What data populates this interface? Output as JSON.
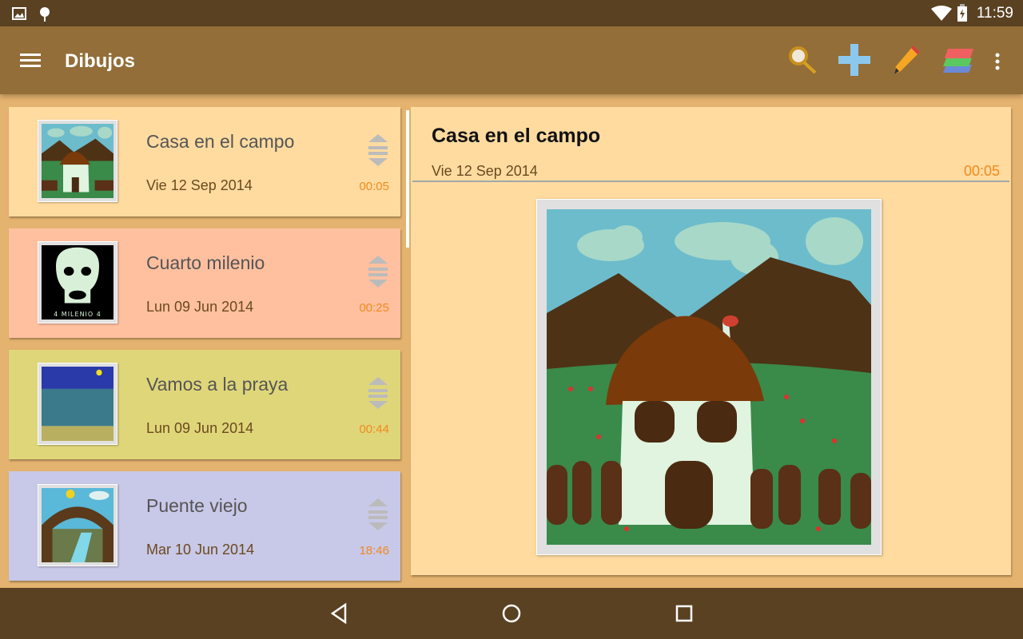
{
  "status": {
    "time": "11:59",
    "icons": [
      "image-icon",
      "android-icon",
      "wifi-icon",
      "battery-charging-icon"
    ]
  },
  "toolbar": {
    "title": "Dibujos",
    "actions": [
      "search-icon",
      "add-icon",
      "edit-pencil-icon",
      "layers-icon",
      "overflow-menu-icon"
    ]
  },
  "list": [
    {
      "title": "Casa en el campo",
      "date": "Vie 12 Sep 2014",
      "time": "00:05",
      "color": "#ffdba0"
    },
    {
      "title": "Cuarto milenio",
      "date": "Lun 09 Jun 2014",
      "time": "00:25",
      "color": "#ffc0a0",
      "thumb_caption": "4 MILENIO 4"
    },
    {
      "title": "Vamos a la praya",
      "date": "Lun 09 Jun 2014",
      "time": "00:44",
      "color": "#dfd67a"
    },
    {
      "title": "Puente viejo",
      "date": "Mar 10 Jun 2014",
      "time": "18:46",
      "color": "#c8c8e8"
    }
  ],
  "detail": {
    "title": "Casa en el campo",
    "date": "Vie 12 Sep 2014",
    "time": "00:05"
  },
  "nav": [
    "back-icon",
    "home-icon",
    "recents-icon"
  ]
}
